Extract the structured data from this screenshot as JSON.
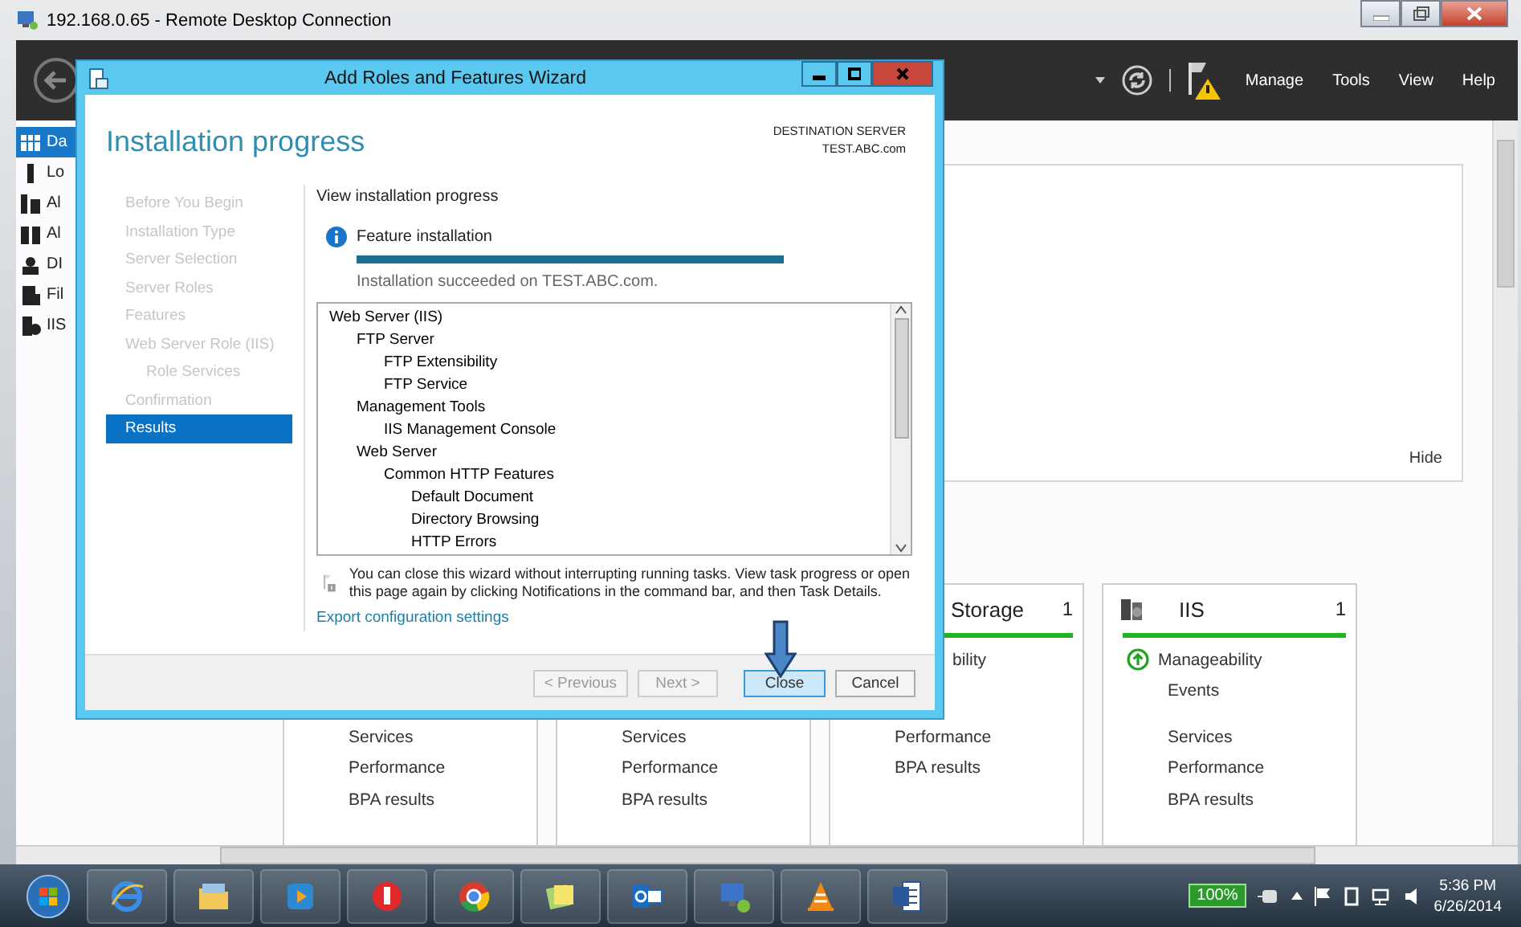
{
  "window": {
    "title": "192.168.0.65 - Remote Desktop Connection"
  },
  "header": {
    "menu": [
      "Manage",
      "Tools",
      "View",
      "Help"
    ]
  },
  "sidebar": {
    "items": [
      {
        "label": "Da",
        "selected": true
      },
      {
        "label": "Lo",
        "selected": false
      },
      {
        "label": "Al",
        "selected": false
      },
      {
        "label": "Al",
        "selected": false
      },
      {
        "label": "DI",
        "selected": false
      },
      {
        "label": "Fil",
        "selected": false
      },
      {
        "label": "IIS",
        "selected": false
      }
    ]
  },
  "dashboard": {
    "hide_label": "Hide",
    "tiles": [
      {
        "kind": "lower",
        "items": [
          "Services",
          "Performance",
          "BPA results"
        ]
      },
      {
        "kind": "lower",
        "items": [
          "Services",
          "Performance",
          "BPA results"
        ]
      },
      {
        "kind": "clipped",
        "title": "Storage",
        "count": "1",
        "color": "#21b521",
        "top_items": [
          {
            "kind": "plain",
            "label": "bility"
          }
        ],
        "items": [
          "Performance",
          "BPA results"
        ]
      },
      {
        "kind": "full",
        "title": "IIS",
        "count": "1",
        "color": "#21b521",
        "top_items": [
          {
            "kind": "status",
            "label": "Manageability",
            "ok": true
          },
          {
            "kind": "plain",
            "label": "Events"
          }
        ],
        "items": [
          "Services",
          "Performance",
          "BPA results"
        ]
      }
    ]
  },
  "wizard": {
    "title": "Add Roles and Features Wizard",
    "heading": "Installation progress",
    "destination_label": "DESTINATION SERVER",
    "destination_server": "TEST.ABC.com",
    "steps": [
      {
        "label": "Before You Begin",
        "selected": false
      },
      {
        "label": "Installation Type",
        "selected": false
      },
      {
        "label": "Server Selection",
        "selected": false
      },
      {
        "label": "Server Roles",
        "selected": false
      },
      {
        "label": "Features",
        "selected": false
      },
      {
        "label": "Web Server Role (IIS)",
        "selected": false,
        "children": [
          {
            "label": "Role Services",
            "selected": false
          }
        ]
      },
      {
        "label": "Confirmation",
        "selected": false
      },
      {
        "label": "Results",
        "selected": true
      }
    ],
    "section_title": "View installation progress",
    "progress": {
      "label": "Feature installation",
      "level": 1,
      "status": "Installation succeeded on TEST.ABC.com."
    },
    "features": [
      {
        "label": "Web Server (IIS)",
        "children": [
          {
            "label": "FTP Server",
            "children": [
              {
                "label": "FTP Extensibility"
              },
              {
                "label": "FTP Service"
              }
            ]
          },
          {
            "label": "Management Tools",
            "children": [
              {
                "label": "IIS Management Console"
              }
            ]
          },
          {
            "label": "Web Server",
            "children": [
              {
                "label": "Common HTTP Features",
                "children": [
                  {
                    "label": "Default Document"
                  },
                  {
                    "label": "Directory Browsing"
                  },
                  {
                    "label": "HTTP Errors"
                  }
                ]
              }
            ]
          }
        ]
      }
    ],
    "note": "You can close this wizard without interrupting running tasks. View task progress or open this page again by clicking Notifications in the command bar, and then Task Details.",
    "link": "Export configuration settings",
    "buttons": [
      {
        "label": "< Previous",
        "disabled": true,
        "default": false
      },
      {
        "label": "Next >",
        "disabled": true,
        "default": false
      },
      {
        "label": "Close",
        "disabled": false,
        "default": true
      },
      {
        "label": "Cancel",
        "disabled": false,
        "default": false
      }
    ]
  },
  "taskbar": {
    "battery": "100%",
    "time": "5:36 PM",
    "date": "6/26/2014"
  }
}
